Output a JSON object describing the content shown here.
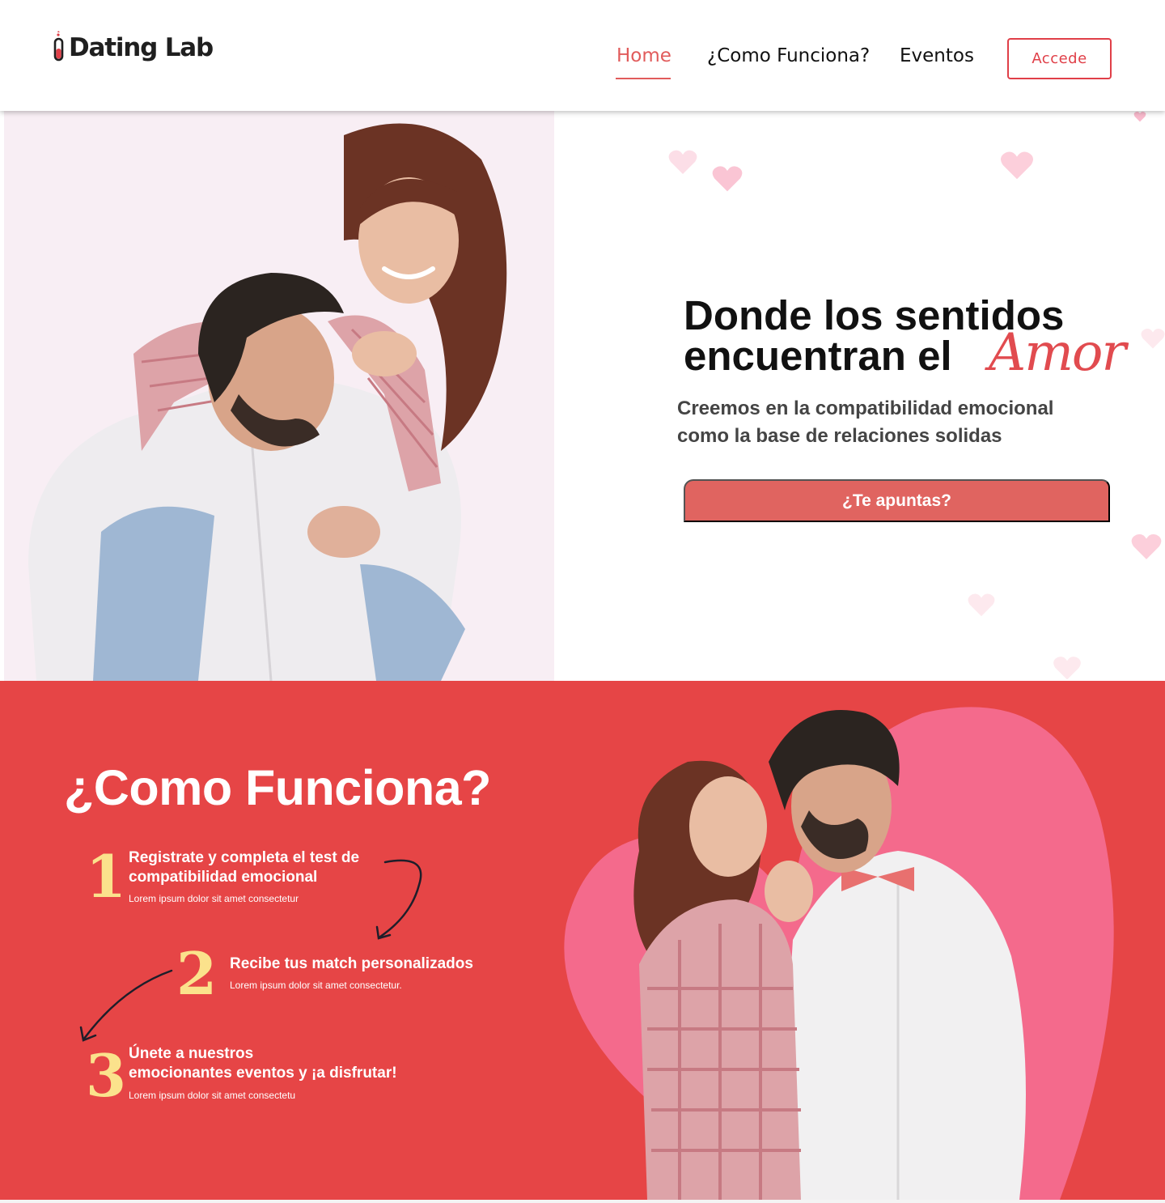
{
  "brand": {
    "name": "Dating Lab"
  },
  "nav": {
    "home": "Home",
    "como_funciona": "¿Como Funciona?",
    "eventos": "Eventos",
    "accede": "Accede"
  },
  "hero": {
    "title_line1": "Donde los sentidos",
    "title_line2": "encuentran el",
    "title_script": "Amor",
    "subtitle_line1": "Creemos en la compatibilidad emocional",
    "subtitle_line2": "como la base de relaciones solidas",
    "cta": "¿Te apuntas?"
  },
  "como": {
    "title": "¿Como Funciona?",
    "steps": [
      {
        "number": "1",
        "title_line1": "Registrate y completa el test de",
        "title_line2": "compatibilidad emocional",
        "desc": "Lorem ipsum dolor sit amet consectetur"
      },
      {
        "number": "2",
        "title_line1": "Recibe tus match personalizados",
        "title_line2": "",
        "desc": "Lorem ipsum dolor sit amet consectetur."
      },
      {
        "number": "3",
        "title_line1": "Únete a nuestros",
        "title_line2": "emocionantes eventos y ¡a disfrutar!",
        "desc": "Lorem ipsum dolor sit amet consectetu"
      }
    ]
  },
  "colors": {
    "accent": "#e15b5b",
    "section_red": "#e64546",
    "heart_pink": "#f46a8c",
    "number_yellow": "#fbe28c"
  }
}
